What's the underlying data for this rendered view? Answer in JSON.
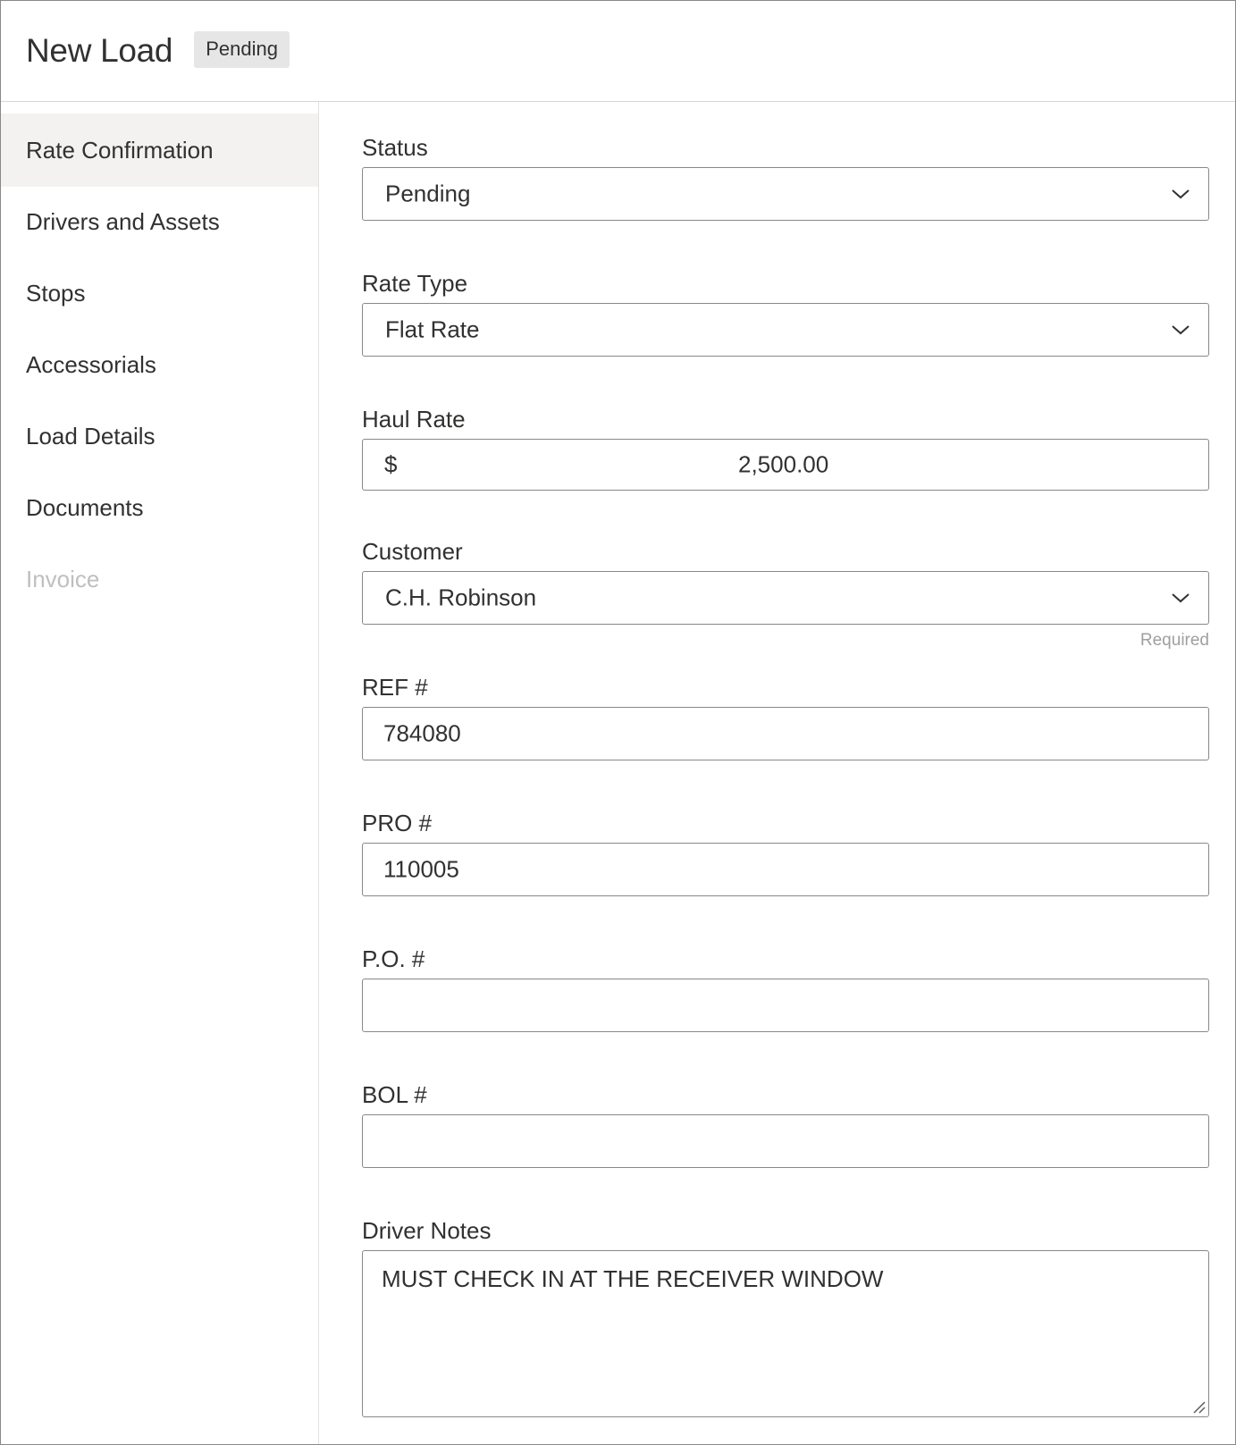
{
  "header": {
    "title": "New Load",
    "badge": "Pending"
  },
  "sidebar": {
    "items": [
      {
        "label": "Rate Confirmation",
        "state": "active"
      },
      {
        "label": "Drivers and Assets",
        "state": "normal"
      },
      {
        "label": "Stops",
        "state": "normal"
      },
      {
        "label": "Accessorials",
        "state": "normal"
      },
      {
        "label": "Load Details",
        "state": "normal"
      },
      {
        "label": "Documents",
        "state": "normal"
      },
      {
        "label": "Invoice",
        "state": "disabled"
      }
    ]
  },
  "form": {
    "status": {
      "label": "Status",
      "value": "Pending",
      "icon": "chevron-down-icon"
    },
    "rate_type": {
      "label": "Rate Type",
      "value": "Flat Rate",
      "icon": "chevron-down-icon"
    },
    "haul_rate": {
      "label": "Haul Rate",
      "prefix": "$",
      "value": "2,500.00"
    },
    "customer": {
      "label": "Customer",
      "value": "C.H. Robinson",
      "hint": "Required",
      "icon": "chevron-down-icon"
    },
    "ref": {
      "label": "REF #",
      "value": "784080"
    },
    "pro": {
      "label": "PRO #",
      "value": "110005"
    },
    "po": {
      "label": "P.O. #",
      "value": ""
    },
    "bol": {
      "label": "BOL #",
      "value": ""
    },
    "driver_notes": {
      "label": "Driver Notes",
      "value": "MUST CHECK IN AT THE RECEIVER WINDOW"
    }
  },
  "colors": {
    "border": "#8a8886",
    "active_nav_bg": "#f3f2f1",
    "disabled_text": "#c0bfbe",
    "badge_bg": "#e6e6e6"
  }
}
